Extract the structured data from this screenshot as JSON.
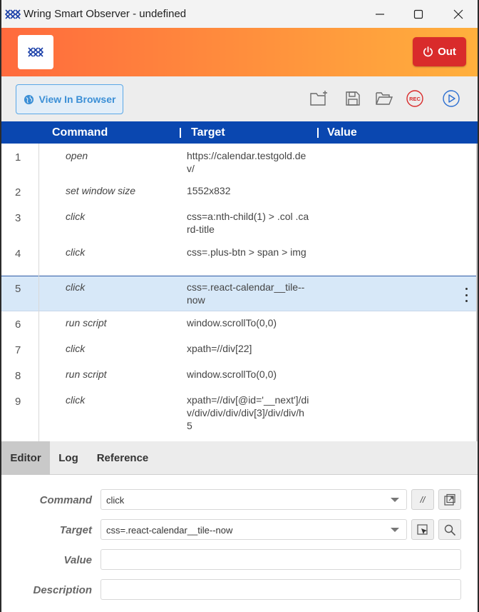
{
  "window": {
    "title": "Wring Smart Observer - undefined"
  },
  "header": {
    "out_label": "Out"
  },
  "toolbar": {
    "view_in_browser_label": "View In Browser",
    "icons": [
      "new-folder-icon",
      "save-icon",
      "open-folder-icon",
      "record-icon",
      "play-icon"
    ],
    "record_label": "REC"
  },
  "table": {
    "columns": [
      "Command",
      "Target",
      "Value"
    ],
    "rows": [
      {
        "n": "1",
        "command": "open",
        "target": "https://calendar.testgold.dev/",
        "value": ""
      },
      {
        "n": "2",
        "command": "set window size",
        "target": "1552x832",
        "value": ""
      },
      {
        "n": "3",
        "command": "click",
        "target": "css=a:nth-child(1) > .col .card-title",
        "value": ""
      },
      {
        "n": "4",
        "command": "click",
        "target": "css=.plus-btn > span > img",
        "value": ""
      },
      {
        "n": "5",
        "command": "click",
        "target": "css=.react-calendar__tile--now",
        "value": "",
        "selected": true
      },
      {
        "n": "6",
        "command": "run script",
        "target": "window.scrollTo(0,0)",
        "value": ""
      },
      {
        "n": "7",
        "command": "click",
        "target": "xpath=//div[22]",
        "value": ""
      },
      {
        "n": "8",
        "command": "run script",
        "target": "window.scrollTo(0,0)",
        "value": ""
      },
      {
        "n": "9",
        "command": "click",
        "target": "xpath=//div[@id='__next']/div/div/div/div/div[3]/div/div/h5",
        "value": ""
      }
    ]
  },
  "tabs": [
    "Editor",
    "Log",
    "Reference"
  ],
  "active_tab": "Editor",
  "editor": {
    "command_label": "Command",
    "command_value": "click",
    "comment_toggle_label": "//",
    "target_label": "Target",
    "target_value": "css=.react-calendar__tile--now",
    "value_label": "Value",
    "value_value": "",
    "description_label": "Description",
    "description_value": ""
  },
  "colors": {
    "header_gradient_start": "#ff6a3d",
    "header_gradient_end": "#ffb03d",
    "out_button": "#d92b2b",
    "table_header": "#0a47b0",
    "selected_row": "#d7e8f8",
    "accent_blue": "#3b8fd6"
  }
}
